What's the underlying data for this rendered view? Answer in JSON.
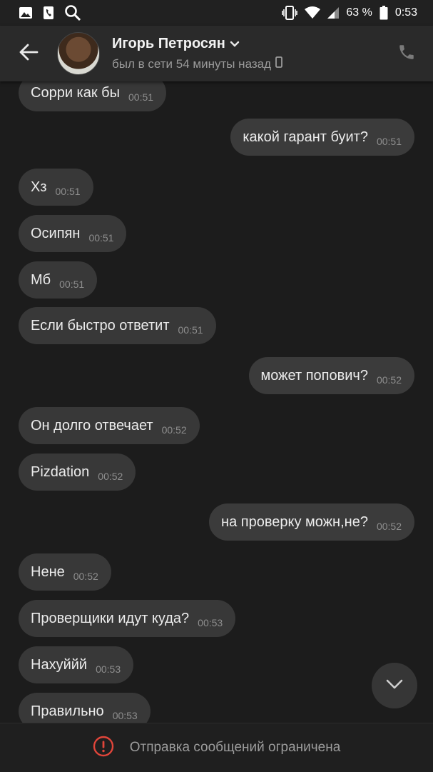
{
  "status_bar": {
    "left_icons": [
      "image-icon",
      "phone-notification-icon",
      "search-icon"
    ],
    "right_icons": [
      "vibrate-icon",
      "wifi-icon",
      "signal-icon",
      "battery-icon"
    ],
    "battery": "63 %",
    "time": "0:53"
  },
  "header": {
    "name": "Игорь Петросян",
    "status": "был в сети 54 минуты назад",
    "icons": [
      "back-arrow-icon",
      "chevron-down-icon",
      "mobile-device-icon",
      "phone-call-icon"
    ]
  },
  "messages": [
    {
      "direction": "in",
      "text": "Сорри как бы",
      "time": "00:51"
    },
    {
      "direction": "out",
      "text": "какой гарант буит?",
      "time": "00:51"
    },
    {
      "direction": "in",
      "text": "Хз",
      "time": "00:51"
    },
    {
      "direction": "in",
      "text": "Осипян",
      "time": "00:51"
    },
    {
      "direction": "in",
      "text": "Мб",
      "time": "00:51"
    },
    {
      "direction": "in",
      "text": "Если быстро ответит",
      "time": "00:51"
    },
    {
      "direction": "out",
      "text": "может попович?",
      "time": "00:52"
    },
    {
      "direction": "in",
      "text": "Он долго отвечает",
      "time": "00:52"
    },
    {
      "direction": "in",
      "text": "Pizdation",
      "time": "00:52"
    },
    {
      "direction": "out",
      "text": "на проверку можн,не?",
      "time": "00:52"
    },
    {
      "direction": "in",
      "text": "Нене",
      "time": "00:52"
    },
    {
      "direction": "in",
      "text": "Проверщики идут куда?",
      "time": "00:53"
    },
    {
      "direction": "in",
      "text": "Нахуййй",
      "time": "00:53"
    },
    {
      "direction": "in",
      "text": "Правильно",
      "time": "00:53"
    }
  ],
  "scroll_button_icon": "chevron-down-icon",
  "footer": {
    "icon": "alert-circle-icon",
    "accent": "#e0453a",
    "text": "Отправка сообщений ограничена"
  }
}
